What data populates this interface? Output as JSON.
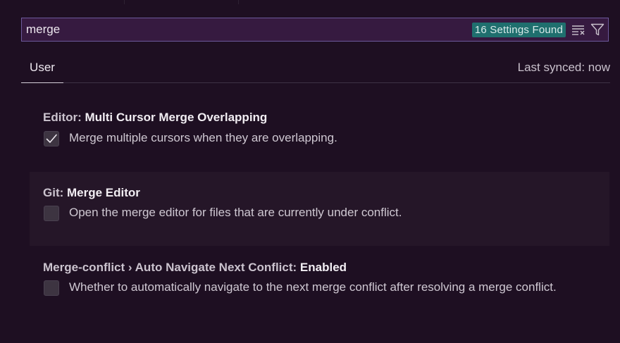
{
  "search": {
    "value": "merge",
    "results_badge": "16 Settings Found"
  },
  "tabs": {
    "user_label": "User",
    "sync_status": "Last synced: now"
  },
  "settings": [
    {
      "category": "Editor: ",
      "label": "Multi Cursor Merge Overlapping",
      "description": "Merge multiple cursors when they are overlapping.",
      "checked": true
    },
    {
      "category": "Git: ",
      "label": "Merge Editor",
      "description": "Open the merge editor for files that are currently under conflict.",
      "checked": false
    },
    {
      "category": "Merge-conflict › Auto Navigate Next Conflict: ",
      "label": "Enabled",
      "description": "Whether to automatically navigate to the next merge conflict after resolving a merge conflict.",
      "checked": false
    }
  ],
  "colors": {
    "background": "#1e0f22",
    "search_background": "#361a40",
    "search_border": "#6d5a9c",
    "badge_background": "#1f6f6e",
    "highlight_row": "#251628",
    "checkbox_background": "#3d3441"
  },
  "icons": {
    "clear_filter": "clear-filter-icon",
    "filter": "filter-icon",
    "checkmark": "checkmark-icon"
  }
}
